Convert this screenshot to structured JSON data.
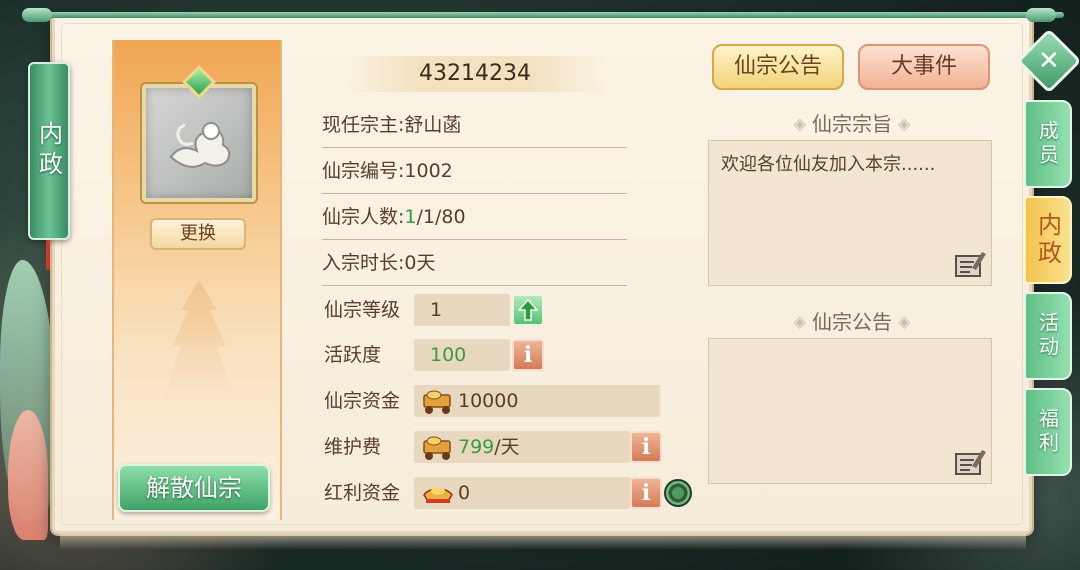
{
  "left_banner": {
    "label": "内政"
  },
  "portrait": {
    "change_label": "更换"
  },
  "disband": {
    "label": "解散仙宗"
  },
  "sect_id": "43214234",
  "info": {
    "leader_label": "现任宗主:",
    "leader_value": "舒山菡",
    "number_label": "仙宗编号:",
    "number_value": "1002",
    "members_label": "仙宗人数:",
    "members_current": "1",
    "members_rest": "/1/80",
    "duration_label": "入宗时长:",
    "duration_value": "0天"
  },
  "stats": {
    "level_label": "仙宗等级",
    "level_value": "1",
    "activity_label": "活跃度",
    "activity_value": "100",
    "funds_label": "仙宗资金",
    "funds_value": "10000",
    "upkeep_label": "维护费",
    "upkeep_value": "799",
    "upkeep_unit": "/天",
    "bonus_label": "红利资金",
    "bonus_value": "0"
  },
  "tabs": {
    "notice": "仙宗公告",
    "events": "大事件"
  },
  "purpose": {
    "title": "仙宗宗旨",
    "text": "欢迎各位仙友加入本宗......"
  },
  "announcement": {
    "title": "仙宗公告",
    "text": ""
  },
  "side_tabs": [
    {
      "label": "成员",
      "active": false
    },
    {
      "label": "内政",
      "active": true
    },
    {
      "label": "活动",
      "active": false
    },
    {
      "label": "福利",
      "active": false
    }
  ],
  "colors": {
    "accent_green": "#3a9a43",
    "tab_active": "#f5c24c",
    "panel": "#f6ecda"
  }
}
